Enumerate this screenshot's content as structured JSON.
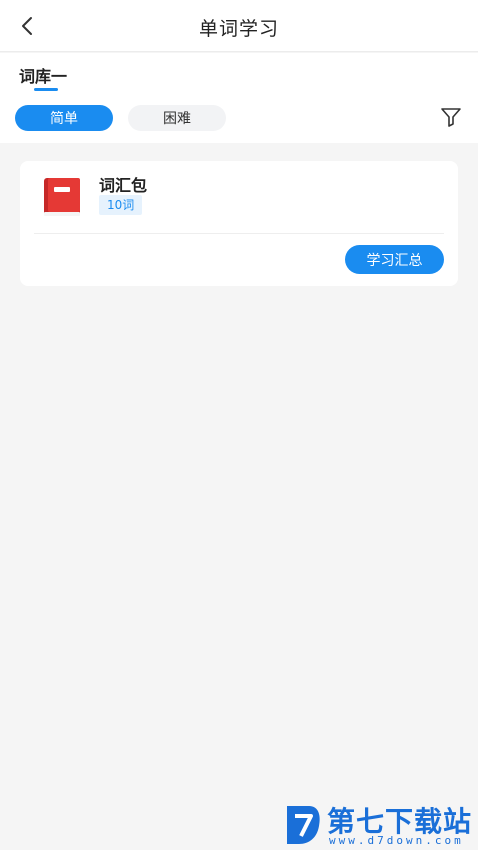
{
  "header": {
    "title": "单词学习",
    "back_icon": "chevron-left-icon"
  },
  "library_tabs": [
    {
      "label": "词库一",
      "active": true
    }
  ],
  "difficulty_chips": [
    {
      "label": "简单",
      "selected": true
    },
    {
      "label": "困难",
      "selected": false
    }
  ],
  "filter_icon": "filter-funnel-icon",
  "vocab_card": {
    "icon": "red-book-icon",
    "name": "词汇包",
    "count_badge": "10词",
    "action_label": "学习汇总"
  },
  "watermark": {
    "name": "第七下载站",
    "url": "www.d7down.com"
  },
  "colors": {
    "accent": "#1a8cf0",
    "background": "#f5f5f5",
    "book_red": "#e53935",
    "watermark_blue": "#1a6fd8"
  }
}
